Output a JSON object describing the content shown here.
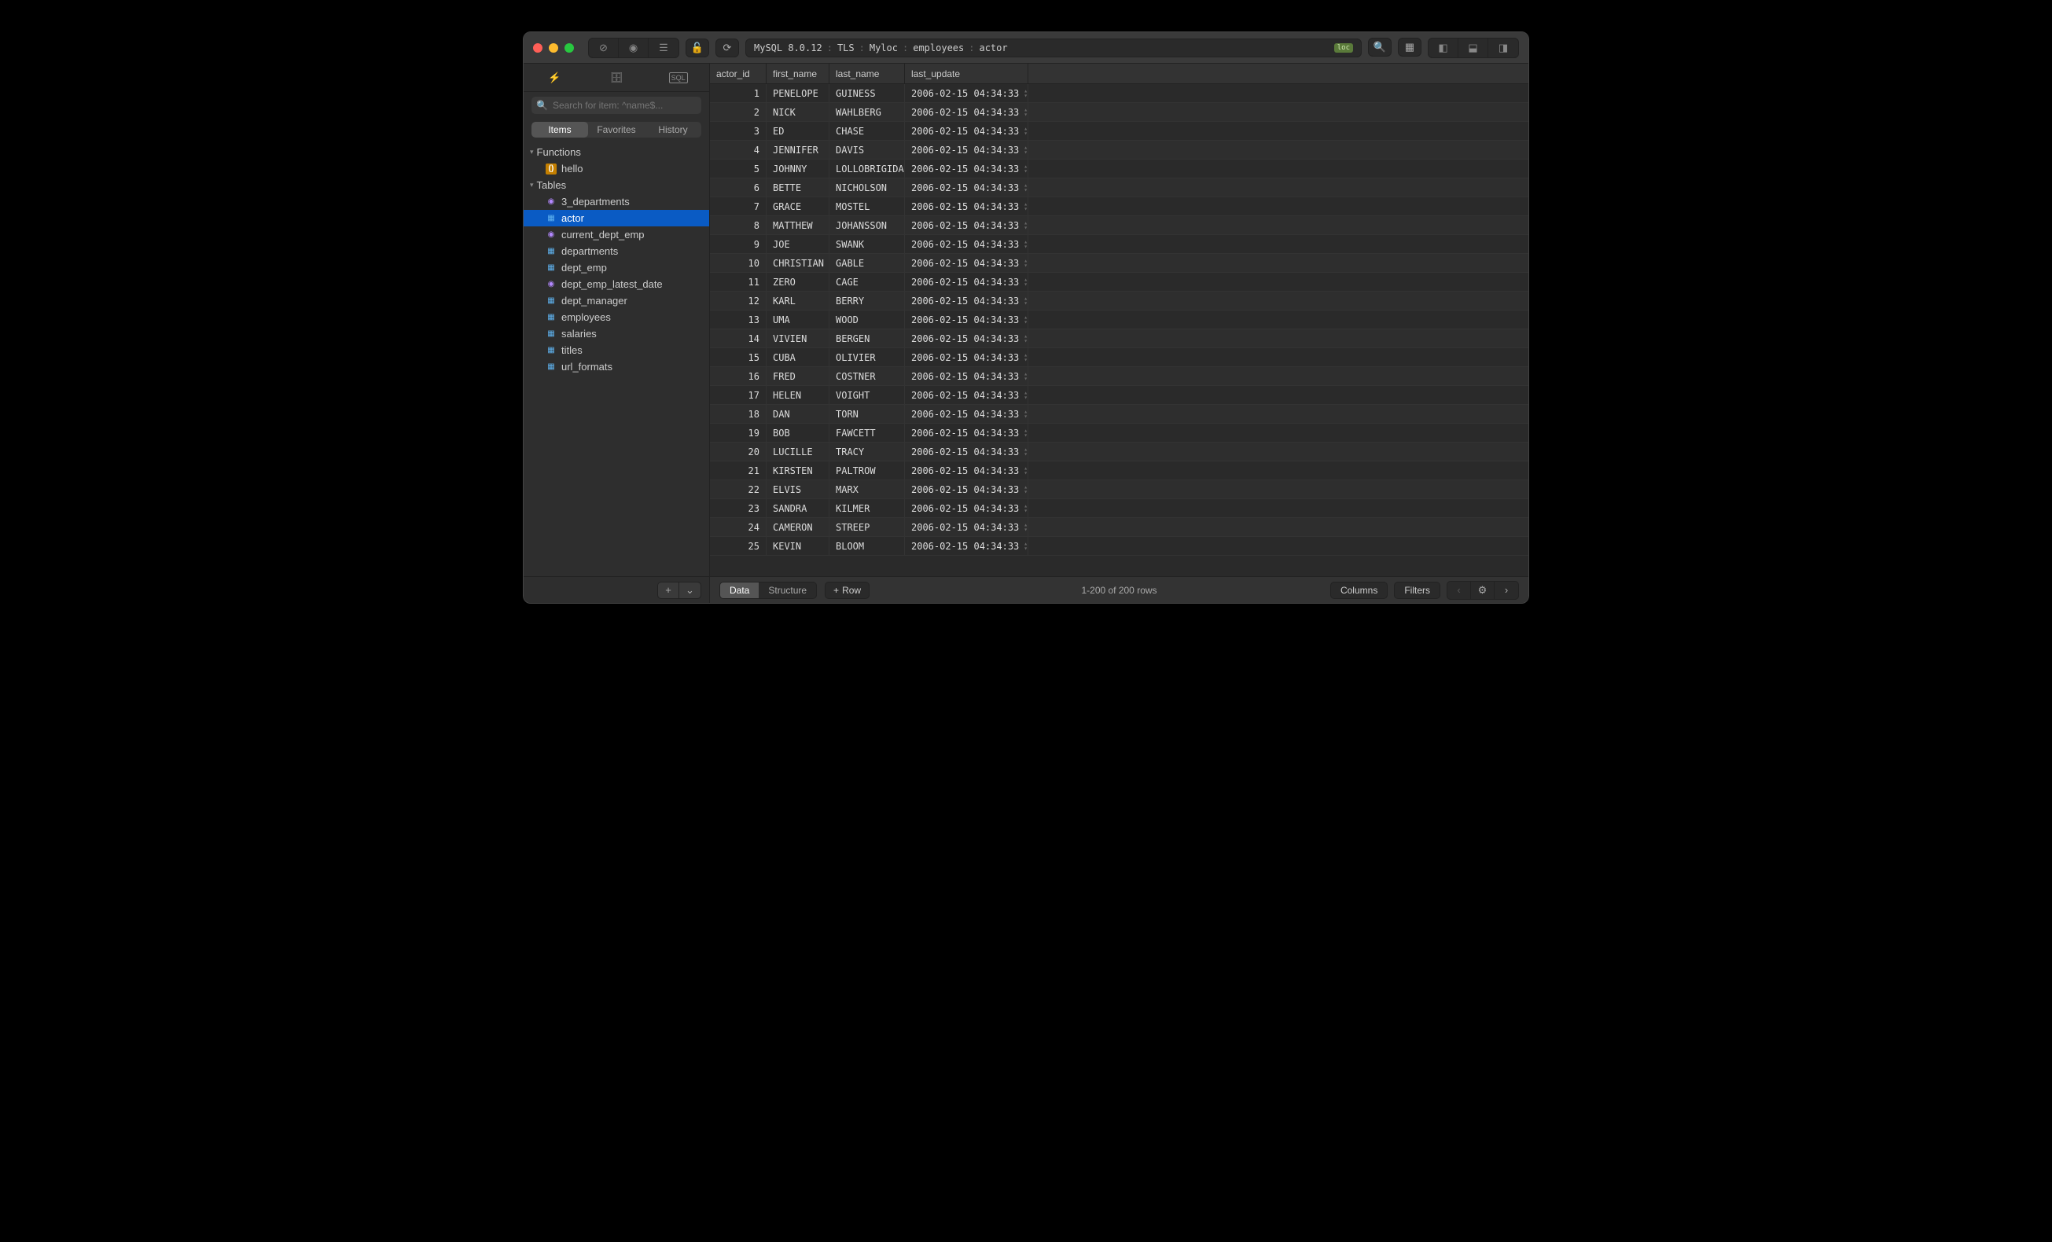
{
  "breadcrumb": {
    "engine": "MySQL 8.0.12",
    "tls": "TLS",
    "host": "Myloc",
    "database": "employees",
    "table": "actor",
    "badge": "loc"
  },
  "sidebar": {
    "search_placeholder": "Search for item: ^name$...",
    "tabs": {
      "items": "Items",
      "favorites": "Favorites",
      "history": "History"
    },
    "sections": {
      "functions": {
        "label": "Functions",
        "items": [
          {
            "name": "hello",
            "type": "func"
          }
        ]
      },
      "tables": {
        "label": "Tables",
        "items": [
          {
            "name": "3_departments",
            "type": "view"
          },
          {
            "name": "actor",
            "type": "table",
            "selected": true
          },
          {
            "name": "current_dept_emp",
            "type": "view"
          },
          {
            "name": "departments",
            "type": "table"
          },
          {
            "name": "dept_emp",
            "type": "table"
          },
          {
            "name": "dept_emp_latest_date",
            "type": "view"
          },
          {
            "name": "dept_manager",
            "type": "table"
          },
          {
            "name": "employees",
            "type": "table"
          },
          {
            "name": "salaries",
            "type": "table"
          },
          {
            "name": "titles",
            "type": "table"
          },
          {
            "name": "url_formats",
            "type": "table"
          }
        ]
      }
    }
  },
  "grid": {
    "columns": [
      {
        "key": "actor_id",
        "label": "actor_id"
      },
      {
        "key": "first_name",
        "label": "first_name"
      },
      {
        "key": "last_name",
        "label": "last_name"
      },
      {
        "key": "last_update",
        "label": "last_update"
      }
    ],
    "rows": [
      {
        "actor_id": 1,
        "first_name": "PENELOPE",
        "last_name": "GUINESS",
        "last_update": "2006-02-15 04:34:33"
      },
      {
        "actor_id": 2,
        "first_name": "NICK",
        "last_name": "WAHLBERG",
        "last_update": "2006-02-15 04:34:33"
      },
      {
        "actor_id": 3,
        "first_name": "ED",
        "last_name": "CHASE",
        "last_update": "2006-02-15 04:34:33"
      },
      {
        "actor_id": 4,
        "first_name": "JENNIFER",
        "last_name": "DAVIS",
        "last_update": "2006-02-15 04:34:33"
      },
      {
        "actor_id": 5,
        "first_name": "JOHNNY",
        "last_name": "LOLLOBRIGIDA",
        "last_update": "2006-02-15 04:34:33"
      },
      {
        "actor_id": 6,
        "first_name": "BETTE",
        "last_name": "NICHOLSON",
        "last_update": "2006-02-15 04:34:33"
      },
      {
        "actor_id": 7,
        "first_name": "GRACE",
        "last_name": "MOSTEL",
        "last_update": "2006-02-15 04:34:33"
      },
      {
        "actor_id": 8,
        "first_name": "MATTHEW",
        "last_name": "JOHANSSON",
        "last_update": "2006-02-15 04:34:33"
      },
      {
        "actor_id": 9,
        "first_name": "JOE",
        "last_name": "SWANK",
        "last_update": "2006-02-15 04:34:33"
      },
      {
        "actor_id": 10,
        "first_name": "CHRISTIAN",
        "last_name": "GABLE",
        "last_update": "2006-02-15 04:34:33"
      },
      {
        "actor_id": 11,
        "first_name": "ZERO",
        "last_name": "CAGE",
        "last_update": "2006-02-15 04:34:33"
      },
      {
        "actor_id": 12,
        "first_name": "KARL",
        "last_name": "BERRY",
        "last_update": "2006-02-15 04:34:33"
      },
      {
        "actor_id": 13,
        "first_name": "UMA",
        "last_name": "WOOD",
        "last_update": "2006-02-15 04:34:33"
      },
      {
        "actor_id": 14,
        "first_name": "VIVIEN",
        "last_name": "BERGEN",
        "last_update": "2006-02-15 04:34:33"
      },
      {
        "actor_id": 15,
        "first_name": "CUBA",
        "last_name": "OLIVIER",
        "last_update": "2006-02-15 04:34:33"
      },
      {
        "actor_id": 16,
        "first_name": "FRED",
        "last_name": "COSTNER",
        "last_update": "2006-02-15 04:34:33"
      },
      {
        "actor_id": 17,
        "first_name": "HELEN",
        "last_name": "VOIGHT",
        "last_update": "2006-02-15 04:34:33"
      },
      {
        "actor_id": 18,
        "first_name": "DAN",
        "last_name": "TORN",
        "last_update": "2006-02-15 04:34:33"
      },
      {
        "actor_id": 19,
        "first_name": "BOB",
        "last_name": "FAWCETT",
        "last_update": "2006-02-15 04:34:33"
      },
      {
        "actor_id": 20,
        "first_name": "LUCILLE",
        "last_name": "TRACY",
        "last_update": "2006-02-15 04:34:33"
      },
      {
        "actor_id": 21,
        "first_name": "KIRSTEN",
        "last_name": "PALTROW",
        "last_update": "2006-02-15 04:34:33"
      },
      {
        "actor_id": 22,
        "first_name": "ELVIS",
        "last_name": "MARX",
        "last_update": "2006-02-15 04:34:33"
      },
      {
        "actor_id": 23,
        "first_name": "SANDRA",
        "last_name": "KILMER",
        "last_update": "2006-02-15 04:34:33"
      },
      {
        "actor_id": 24,
        "first_name": "CAMERON",
        "last_name": "STREEP",
        "last_update": "2006-02-15 04:34:33"
      },
      {
        "actor_id": 25,
        "first_name": "KEVIN",
        "last_name": "BLOOM",
        "last_update": "2006-02-15 04:34:33"
      }
    ]
  },
  "footer": {
    "data_tab": "Data",
    "structure_tab": "Structure",
    "row_button": "Row",
    "status": "1-200 of 200 rows",
    "columns_btn": "Columns",
    "filters_btn": "Filters"
  }
}
